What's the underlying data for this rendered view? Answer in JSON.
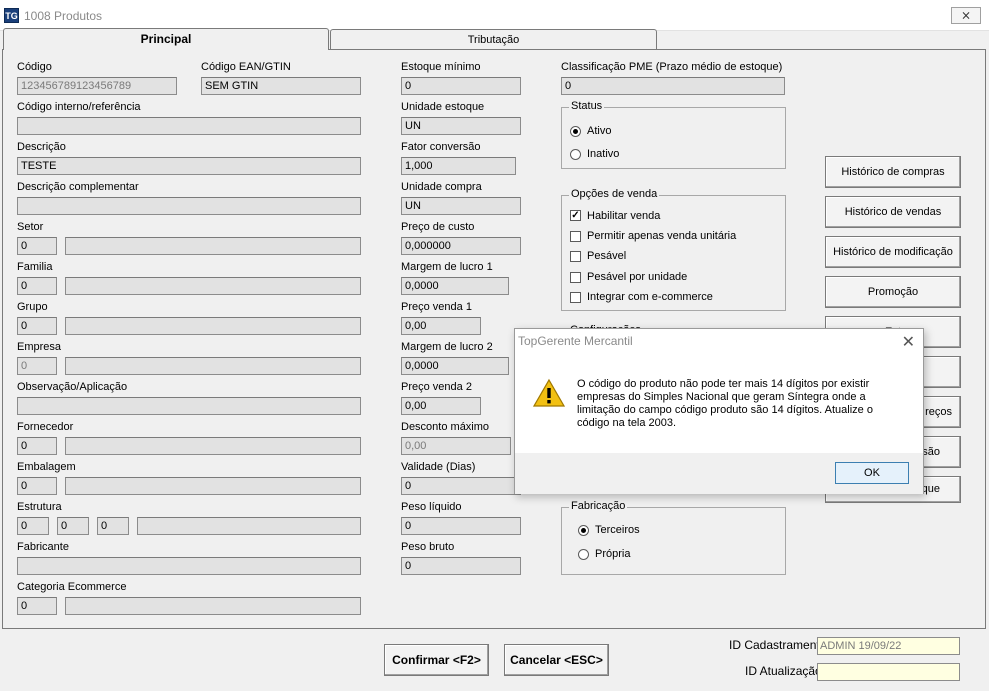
{
  "window": {
    "title": "1008 Produtos",
    "icon_text": "TG",
    "close_symbol": "⨯"
  },
  "tabs": [
    {
      "label": "Principal"
    },
    {
      "label": "Tributação"
    }
  ],
  "col1": {
    "codigo": {
      "label": "Código",
      "value": "123456789123456789"
    },
    "ean": {
      "label": "Código EAN/GTIN",
      "value": "SEM GTIN"
    },
    "codigo_interno": {
      "label": "Código interno/referência",
      "value": ""
    },
    "descricao": {
      "label": "Descrição",
      "value": "TESTE"
    },
    "descricao_comp": {
      "label": "Descrição complementar",
      "value": ""
    },
    "setor": {
      "label": "Setor",
      "code": "0",
      "name": ""
    },
    "familia": {
      "label": "Familia",
      "code": "0",
      "name": ""
    },
    "grupo": {
      "label": "Grupo",
      "code": "0",
      "name": ""
    },
    "empresa": {
      "label": "Empresa",
      "code": "0",
      "name": ""
    },
    "observacao": {
      "label": "Observação/Aplicação",
      "value": ""
    },
    "fornecedor": {
      "label": "Fornecedor",
      "code": "0",
      "name": ""
    },
    "embalagem": {
      "label": "Embalagem",
      "code": "0",
      "name": ""
    },
    "estrutura": {
      "label": "Estrutura",
      "v1": "0",
      "v2": "0",
      "v3": "0",
      "name": ""
    },
    "fabricante": {
      "label": "Fabricante",
      "value": ""
    },
    "categoria": {
      "label": "Categoria Ecommerce",
      "code": "0",
      "name": ""
    }
  },
  "col2": {
    "estoque_min": {
      "label": "Estoque mínimo",
      "value": "0"
    },
    "unidade_estoque": {
      "label": "Unidade estoque",
      "value": "UN"
    },
    "fator": {
      "label": "Fator conversão",
      "value": "1,000"
    },
    "unidade_compra": {
      "label": "Unidade compra",
      "value": "UN"
    },
    "preco_custo": {
      "label": "Preço de custo",
      "value": "0,000000"
    },
    "margem1": {
      "label": "Margem de lucro 1",
      "value": "0,0000"
    },
    "preco1": {
      "label": "Preço venda 1",
      "value": "0,00"
    },
    "margem2": {
      "label": "Margem de lucro 2",
      "value": "0,0000"
    },
    "preco2": {
      "label": "Preço venda 2",
      "value": "0,00"
    },
    "desconto": {
      "label": "Desconto máximo",
      "value": "0,00"
    },
    "validade": {
      "label": "Validade (Dias)",
      "value": "0"
    },
    "peso_liquido": {
      "label": "Peso líquido",
      "value": "0"
    },
    "peso_bruto": {
      "label": "Peso bruto",
      "value": "0"
    }
  },
  "col3": {
    "pme": {
      "label": "Classificação PME (Prazo médio de estoque)",
      "value": "0"
    },
    "status": {
      "title": "Status",
      "opt1": "Ativo",
      "opt2": "Inativo"
    },
    "vendas": {
      "title": "Opções de venda",
      "opt1": "Habilitar venda",
      "opt2": "Permitir apenas venda unitária",
      "opt3": "Pesável",
      "opt4": "Pesável por unidade",
      "opt5": "Integrar com e-commerce"
    },
    "config_partial": "Configurações",
    "fabricacao": {
      "title": "Fabricação",
      "opt1": "Terceiros",
      "opt2": "Própria"
    },
    "check_mark": "✓"
  },
  "side_buttons": {
    "b1": "Histórico de compras",
    "b2": "Histórico de vendas",
    "b3": "Histórico de modificação",
    "b4": "Promoção",
    "b5": "Estoque",
    "b6": "",
    "b7": "Histórico de preços",
    "b8": "Impressão",
    "b9": "Ajuste de estoque",
    "b5_visible": "Est",
    "b7_visible": "reços",
    "b8_visible": "ssão",
    "b9_visible": "que"
  },
  "footer": {
    "confirm": "Confirmar <F2>",
    "cancel": "Cancelar <ESC>",
    "id_cad_label": "ID Cadastramento",
    "id_cad_value": "ADMIN 19/09/22",
    "id_atu_label": "ID Atualização",
    "id_atu_value": ""
  },
  "dialog": {
    "title": "TopGerente Mercantil",
    "close_symbol": "✕",
    "message": "O código do produto não pode ter mais 14 dígitos por existir empresas do Simples Nacional que geram Síntegra onde a limitação do campo código produto são 14 dígitos. Atualize o código na tela 2003.",
    "ok": "OK",
    "icon": "warning-icon"
  },
  "colors": {
    "dialog_ok_border": "#3c7fb1",
    "footer_field_bg": "#ffffe1",
    "warning": "#f2c012"
  }
}
